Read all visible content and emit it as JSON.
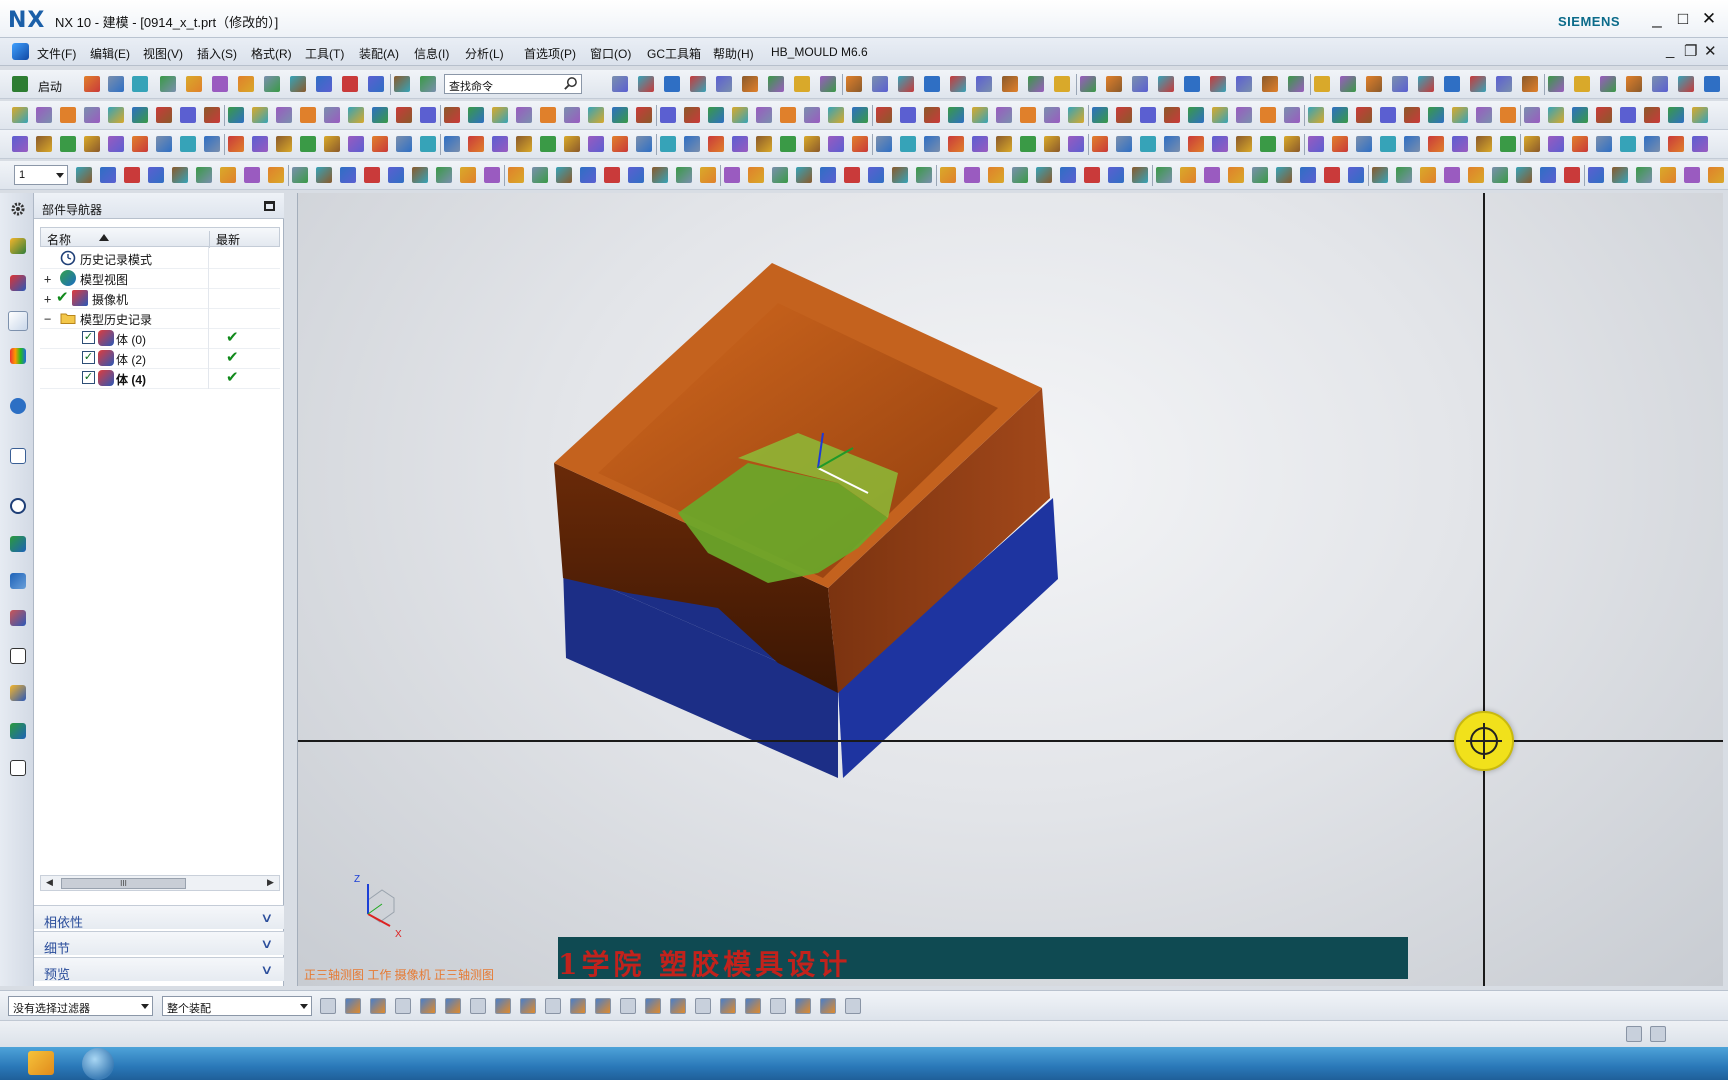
{
  "window": {
    "logo": "NX",
    "title": "NX 10 - 建模 - [0914_x_t.prt（修改的）]",
    "brand": "SIEMENS",
    "controls": [
      "_",
      "□",
      "✕"
    ]
  },
  "menu": {
    "items": [
      "文件(F)",
      "编辑(E)",
      "视图(V)",
      "插入(S)",
      "格式(R)",
      "工具(T)",
      "装配(A)",
      "信息(I)",
      "分析(L)",
      "首选项(P)",
      "窗口(O)",
      "GC工具箱",
      "帮助(H)",
      "HB_MOULD M6.6"
    ],
    "right_controls": [
      "_",
      "❐",
      "✕"
    ]
  },
  "toolbar": {
    "start_label": "启动",
    "search_placeholder": "查找命令",
    "layer_value": "1"
  },
  "navigator": {
    "title": "部件导航器",
    "col_name": "名称",
    "col_latest": "最新",
    "rows": [
      {
        "label": "历史记录模式",
        "expander": "",
        "checked": false,
        "latest": false
      },
      {
        "label": "模型视图",
        "expander": "+",
        "checked": false,
        "latest": false
      },
      {
        "label": "摄像机",
        "expander": "+",
        "checked": true,
        "latest": false
      },
      {
        "label": "模型历史记录",
        "expander": "−",
        "checked": false,
        "latest": false
      },
      {
        "label": "体 (0)",
        "expander": "",
        "checked": true,
        "latest": true
      },
      {
        "label": "体 (2)",
        "expander": "",
        "checked": true,
        "latest": true
      },
      {
        "label": "体 (4)",
        "expander": "",
        "checked": true,
        "latest": true
      }
    ],
    "latest_mark": "✔",
    "scroll_thumb": "III",
    "sections": [
      "相依性",
      "细节",
      "预览"
    ],
    "section_chevron": "∨"
  },
  "viewport": {
    "view_labels": "正三轴测图 工作 摄像机 正三轴测图",
    "triad_z": "Z",
    "triad_x": "X",
    "banner_text": "1学院  塑胶模具设计",
    "colors": {
      "cavity_orange": "#b4531a",
      "cavity_dark": "#5a2408",
      "core_blue": "#1a2f8a",
      "part_green": "#6aa82a",
      "cursor_yellow": "#f1e11b"
    }
  },
  "selection_bar": {
    "filter_value": "没有选择过滤器",
    "scope_value": "整个装配"
  }
}
